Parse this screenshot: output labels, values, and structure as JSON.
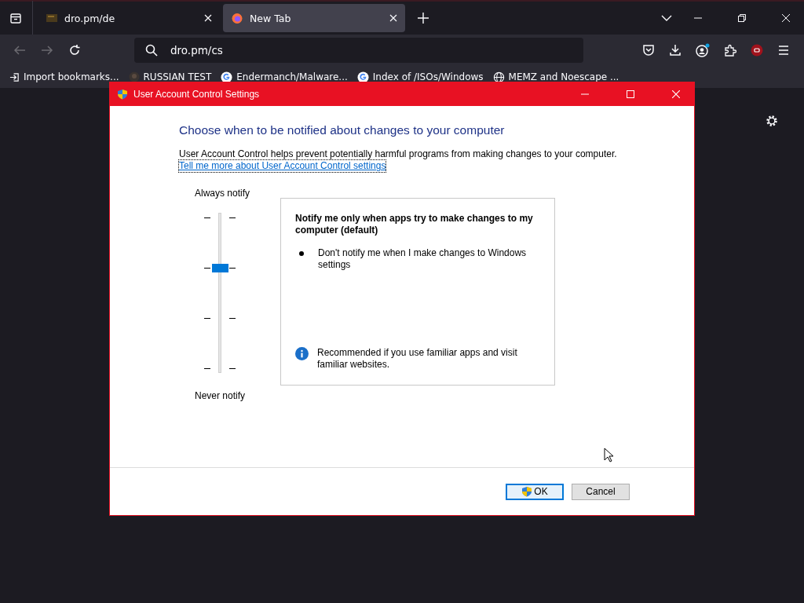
{
  "browser": {
    "tabs": [
      {
        "title": "dro.pm/de",
        "selected": false,
        "kind": "site"
      },
      {
        "title": "New Tab",
        "selected": true,
        "kind": "firefox"
      }
    ],
    "address": "dro.pm/cs",
    "back_disabled": true,
    "forward_disabled": true,
    "bookmarks": [
      {
        "label": "Import bookmarks...",
        "kind": "import"
      },
      {
        "label": "RUSSIAN TEST",
        "kind": "site"
      },
      {
        "label": "Endermanch/Malware...",
        "kind": "google"
      },
      {
        "label": "Index of /ISOs/Windows",
        "kind": "google"
      },
      {
        "label": "MEMZ and Noescape ...",
        "kind": "globe"
      }
    ]
  },
  "dialog": {
    "title": "User Account Control Settings",
    "heading": "Choose when to be notified about changes to your computer",
    "intro": "User Account Control helps prevent potentially harmful programs from making changes to your computer.",
    "link": "Tell me more about User Account Control settings",
    "slider": {
      "top_label": "Always notify",
      "bottom_label": "Never notify",
      "level": 0.667
    },
    "description": {
      "title": "Notify me only when apps try to make changes to my computer (default)",
      "bullets": [
        "Don't notify me when I make changes to Windows settings"
      ],
      "note": "Recommended if you use familiar apps and visit familiar websites."
    },
    "buttons": [
      {
        "label": "OK",
        "default": true,
        "kind": "shield"
      },
      {
        "label": "Cancel",
        "default": false,
        "kind": "plain"
      }
    ]
  }
}
